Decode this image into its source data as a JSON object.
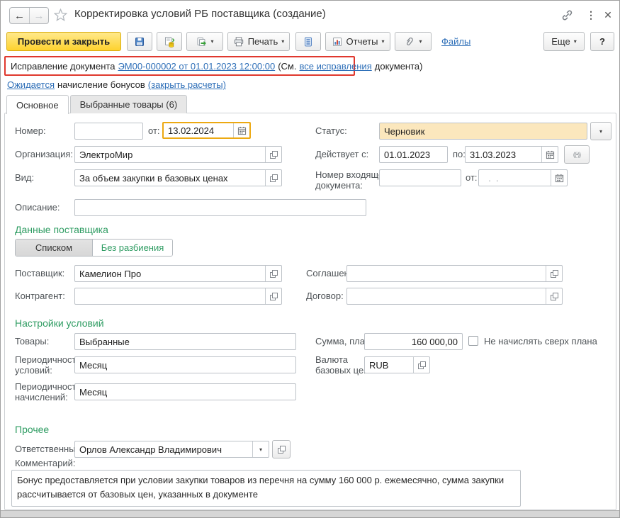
{
  "window": {
    "title": "Корректировка условий РБ поставщика (создание)",
    "help_label": "?"
  },
  "toolbar": {
    "post_and_close": "Провести и закрыть",
    "print_label": "Печать",
    "reports_label": "Отчеты",
    "files_label": "Файлы",
    "more_label": "Еще"
  },
  "banner": {
    "prefix": "Исправление документа",
    "doc_link": "ЭМ00-000002 от 01.01.2023 12:00:00",
    "see": "(См.",
    "all_link": "все исправления",
    "tail": "документа)"
  },
  "bonus_line": {
    "link1": "Ожидается",
    "text": "начисление бонусов",
    "link2": "(закрыть расчеты)"
  },
  "tabs": [
    {
      "label": "Основное"
    },
    {
      "label": "Выбранные товары (6)"
    }
  ],
  "fields": {
    "number_label": "Номер:",
    "number_value": "",
    "date_label": "от:",
    "date_value": "13.02.2024",
    "status_label": "Статус:",
    "status_value": "Черновик",
    "org_label": "Организация:",
    "org_value": "ЭлектроМир",
    "valid_from_label": "Действует с:",
    "valid_from_value": "01.01.2023",
    "valid_to_label": "по:",
    "valid_to_value": "31.03.2023",
    "kind_label": "Вид:",
    "kind_value": "За объем закупки в базовых ценах",
    "incoming_label_line1": "Номер входящего",
    "incoming_label_line2": "документа:",
    "incoming_value": "",
    "incoming_date_label": "от:",
    "incoming_date_value": "  .  .",
    "desc_label": "Описание:",
    "desc_value": ""
  },
  "supplier_section": {
    "title": "Данные поставщика",
    "toggle_list": "Списком",
    "toggle_nobreak": "Без разбиения",
    "supplier_label": "Поставщик:",
    "supplier_value": "Камелион Про",
    "agreement_label": "Соглашение:",
    "agreement_value": "",
    "counterparty_label": "Контрагент:",
    "counterparty_value": "",
    "contract_label": "Договор:",
    "contract_value": ""
  },
  "conditions_section": {
    "title": "Настройки условий",
    "goods_label": "Товары:",
    "goods_value": "Выбранные",
    "amount_label": "Сумма, план:",
    "amount_value": "160 000,00",
    "over_plan_label": "Не начислять сверх плана",
    "over_plan_checked": false,
    "period_cond_line1": "Периодичность",
    "period_cond_line2": "условий:",
    "period_cond_value": "Месяц",
    "currency_line1": "Валюта",
    "currency_line2": "базовых цен:",
    "currency_value": "RUB",
    "period_accr_line1": "Периодичность",
    "period_accr_line2": "начислений:",
    "period_accr_value": "Месяц"
  },
  "other_section": {
    "title": "Прочее",
    "responsible_label": "Ответственный:",
    "responsible_value": "Орлов Александр Владимирович",
    "comment_label": "Комментарий:",
    "comment_value": "Бонус предоставляется при условии закупки товаров из перечня на сумму 160 000 р. ежемесячно, сумма закупки рассчитывается от базовых цен, указанных в документе"
  },
  "colors": {
    "accent_button_yellow": "#fed22e",
    "status_field_yellow": "#fbe7bd",
    "banner_red": "#e0382e",
    "link_blue": "#2e6fb8",
    "section_green": "#2e9c62",
    "focus_orange": "#eca912"
  }
}
